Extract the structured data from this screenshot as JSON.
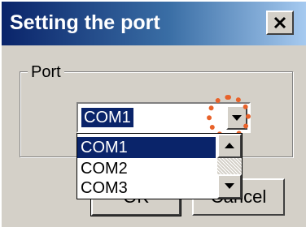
{
  "window": {
    "title": "Setting the port",
    "close_label": "×"
  },
  "group": {
    "label": "Port"
  },
  "combo": {
    "value": "COM1"
  },
  "dropdown": {
    "options": [
      "COM1",
      "COM2",
      "COM3"
    ],
    "selected_index": 0
  },
  "buttons": {
    "ok": "OK",
    "cancel": "Cancel"
  },
  "colors": {
    "title_bar": "#0a246a",
    "selection": "#0a246a",
    "highlight_ring": "#e8622a",
    "face": "#d4d0c8"
  }
}
